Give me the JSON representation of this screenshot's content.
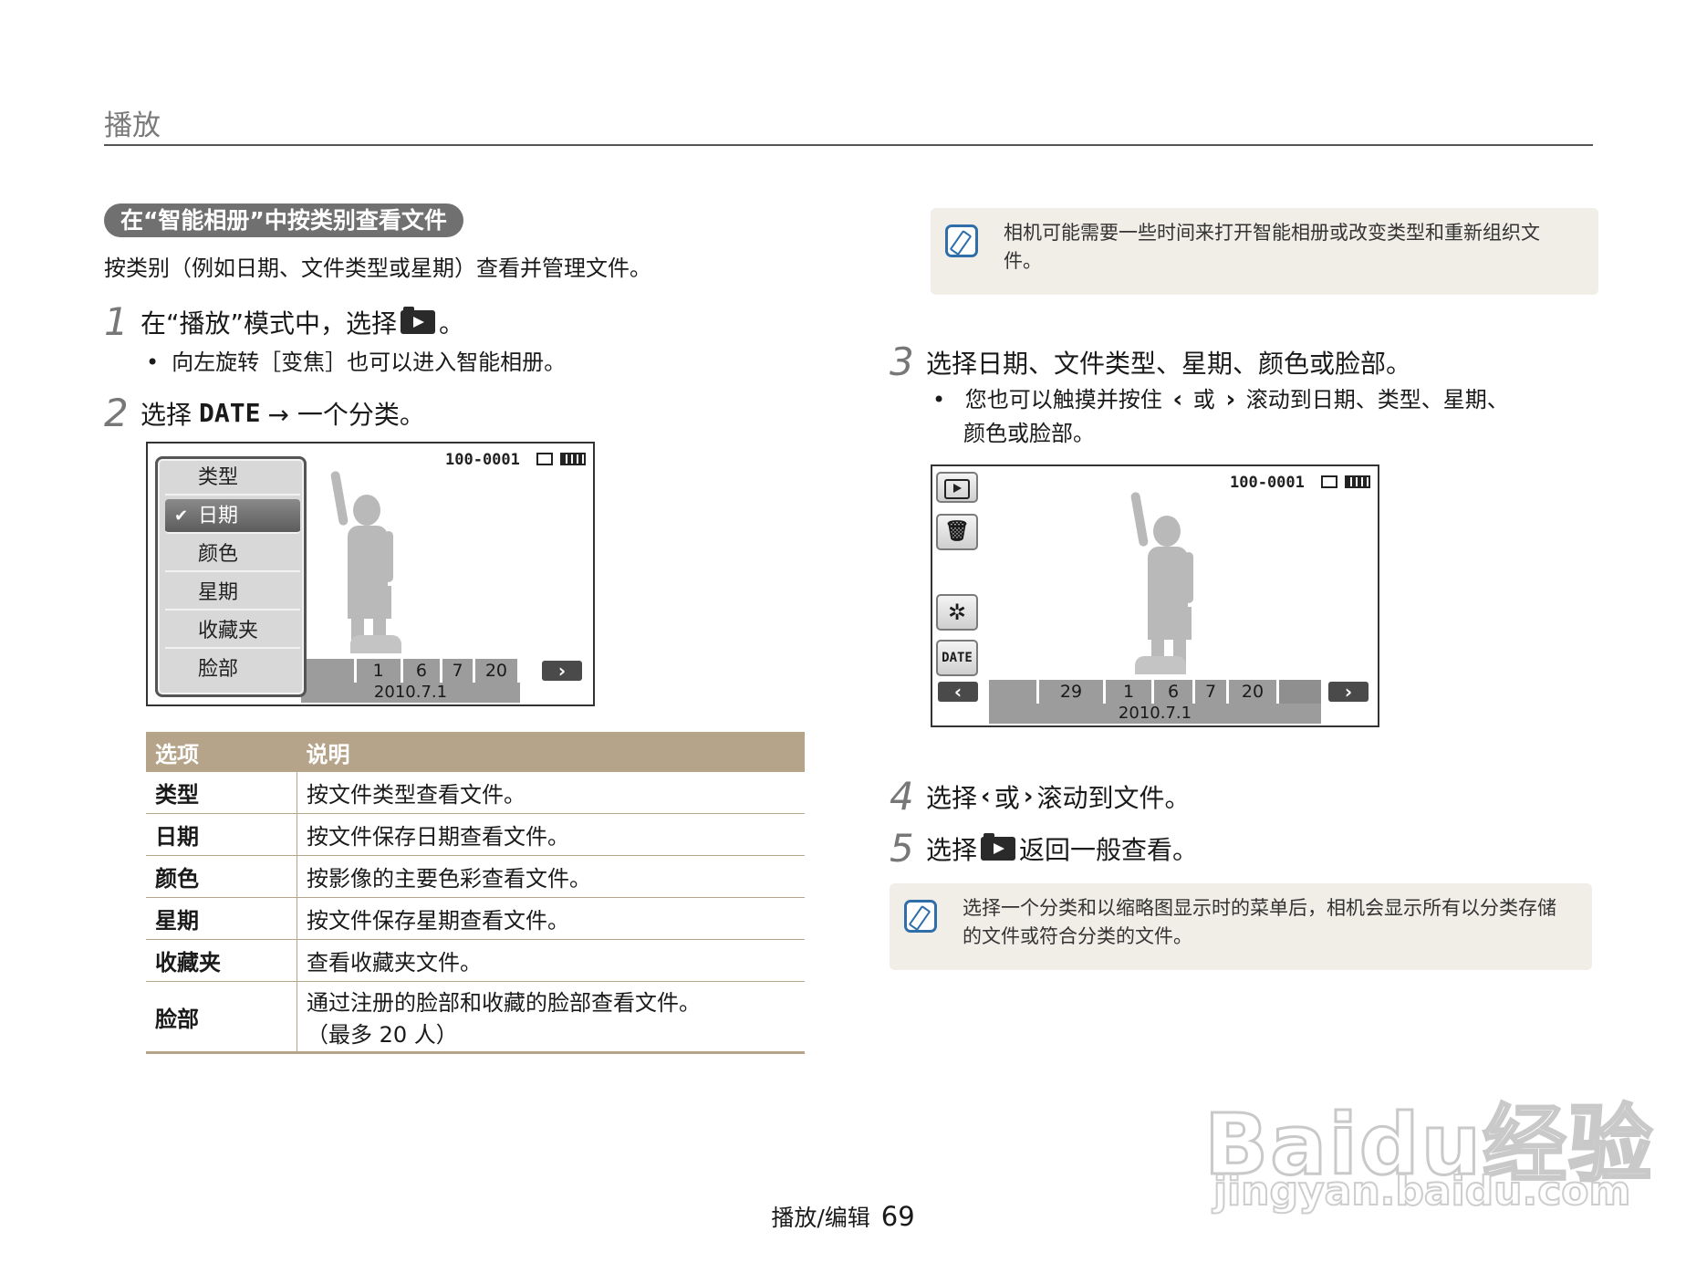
{
  "header": {
    "section": "播放"
  },
  "section": {
    "title": "在“智能相册”中按类别查看文件",
    "intro": "按类别（例如日期、文件类型或星期）查看并管理文件。"
  },
  "steps": {
    "s1": {
      "num": "1",
      "pre": "在“播放”模式中，选择",
      "post": "。"
    },
    "s1_sub": "向左旋转［变焦］也可以进入智能相册。",
    "s2": {
      "num": "2",
      "pre": "选择",
      "date_label": "DATE",
      "post": "→ 一个分类。"
    },
    "s3": {
      "num": "3",
      "text": "选择日期、文件类型、星期、颜色或脸部。"
    },
    "s3_sub1_pre": "您也可以触摸并按住",
    "s3_sub1_mid": "或",
    "s3_sub1_post": "滚动到日期、类型、星期、",
    "s3_sub2": "颜色或脸部。",
    "s4": {
      "num": "4",
      "pre": "选择",
      "mid": "或",
      "post": "滚动到文件。"
    },
    "s5": {
      "num": "5",
      "pre": "选择",
      "post": "返回一般查看。"
    }
  },
  "screen1": {
    "file_no": "100-0001",
    "menu": [
      "类型",
      "日期",
      "颜色",
      "星期",
      "收藏夹",
      "脸部"
    ],
    "selected": "日期",
    "timeline": [
      "1",
      "6",
      "7",
      "20"
    ],
    "date": "2010.7.1"
  },
  "screen2": {
    "file_no": "100-0001",
    "date_btn": "DATE",
    "timeline": [
      "29",
      "1",
      "6",
      "7",
      "20"
    ],
    "date": "2010.7.1"
  },
  "table": {
    "headers": [
      "选项",
      "说明"
    ],
    "rows": [
      {
        "option": "类型",
        "desc": "按文件类型查看文件。"
      },
      {
        "option": "日期",
        "desc": "按文件保存日期查看文件。"
      },
      {
        "option": "颜色",
        "desc": "按影像的主要色彩查看文件。"
      },
      {
        "option": "星期",
        "desc": "按文件保存星期查看文件。"
      },
      {
        "option": "收藏夹",
        "desc": "查看收藏夹文件。"
      },
      {
        "option": "脸部",
        "desc": "通过注册的脸部和收藏的脸部查看文件。",
        "desc2": "（最多 20 人）"
      }
    ]
  },
  "notes": {
    "top_l1": "相机可能需要一些时间来打开智能相册或改变类型和重新组织文",
    "top_l2": "件。",
    "bottom_l1": "选择一个分类和以缩略图显示时的菜单后，相机会显示所有以分类存储",
    "bottom_l2": "的文件或符合分类的文件。"
  },
  "footer": {
    "label": "播放/编辑",
    "page": "69"
  },
  "watermark": {
    "logo": "Baidu经验",
    "url": "jingyan.baidu.com"
  },
  "icons": [
    "play-mode-icon",
    "chevron-left-icon",
    "chevron-right-icon",
    "trash-icon",
    "smart-album-icon",
    "battery-icon",
    "memo-note-icon"
  ]
}
